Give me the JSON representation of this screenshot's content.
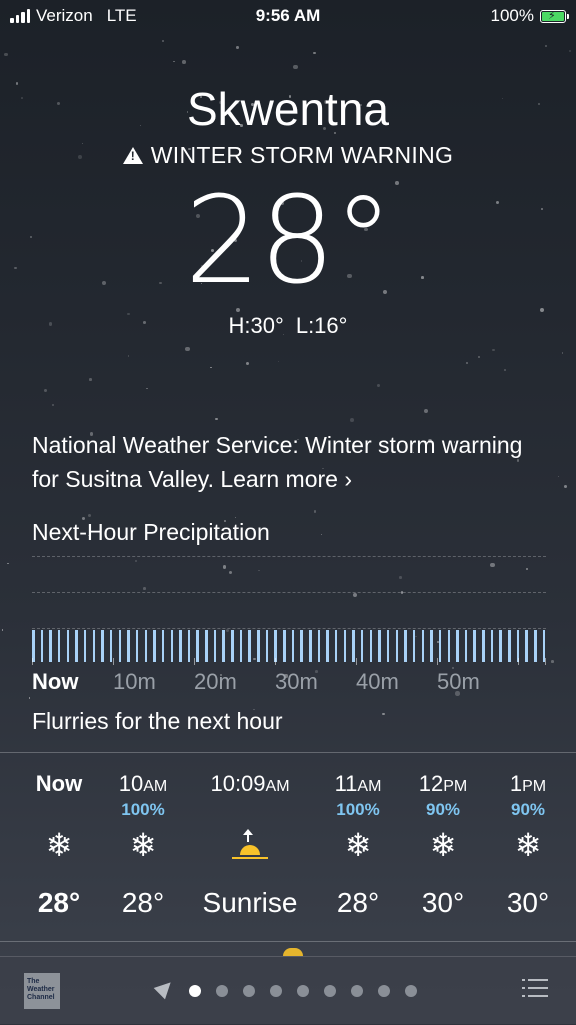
{
  "status_bar": {
    "carrier": "Verizon",
    "network": "LTE",
    "time": "9:56 AM",
    "battery": "100%"
  },
  "header": {
    "city": "Skwentna",
    "alert_title": "WINTER STORM WARNING",
    "temperature": "28°",
    "high": "H:30°",
    "low": "L:16°"
  },
  "alert": {
    "text": "National Weather Service: Winter storm warning for Susitna Valley. Learn more ›"
  },
  "precipitation": {
    "title": "Next-Hour Precipitation",
    "labels": [
      "Now",
      "10m",
      "20m",
      "30m",
      "40m",
      "50m"
    ],
    "summary": "Flurries for the next hour",
    "bar_color": "#a9d2f7"
  },
  "hourly": [
    {
      "time": "Now",
      "suffix": "",
      "pct": "",
      "icon": "snowflake-icon",
      "value": "28°"
    },
    {
      "time": "10",
      "suffix": "AM",
      "pct": "100%",
      "icon": "snowflake-icon",
      "value": "28°"
    },
    {
      "time": "10:09",
      "suffix": "AM",
      "pct": "",
      "icon": "sunrise-icon",
      "value": "Sunrise"
    },
    {
      "time": "11",
      "suffix": "AM",
      "pct": "100%",
      "icon": "snowflake-icon",
      "value": "28°"
    },
    {
      "time": "12",
      "suffix": "PM",
      "pct": "90%",
      "icon": "snowflake-icon",
      "value": "30°"
    },
    {
      "time": "1",
      "suffix": "PM",
      "pct": "90%",
      "icon": "snowflake-icon",
      "value": "30°"
    }
  ],
  "bottom_bar": {
    "logo_text": "The Weather Channel",
    "page_count": 9,
    "active_page": 1
  },
  "colors": {
    "precip_pct": "#7fc5f0",
    "sunrise": "#f8c22a",
    "battery": "#4cd964"
  }
}
